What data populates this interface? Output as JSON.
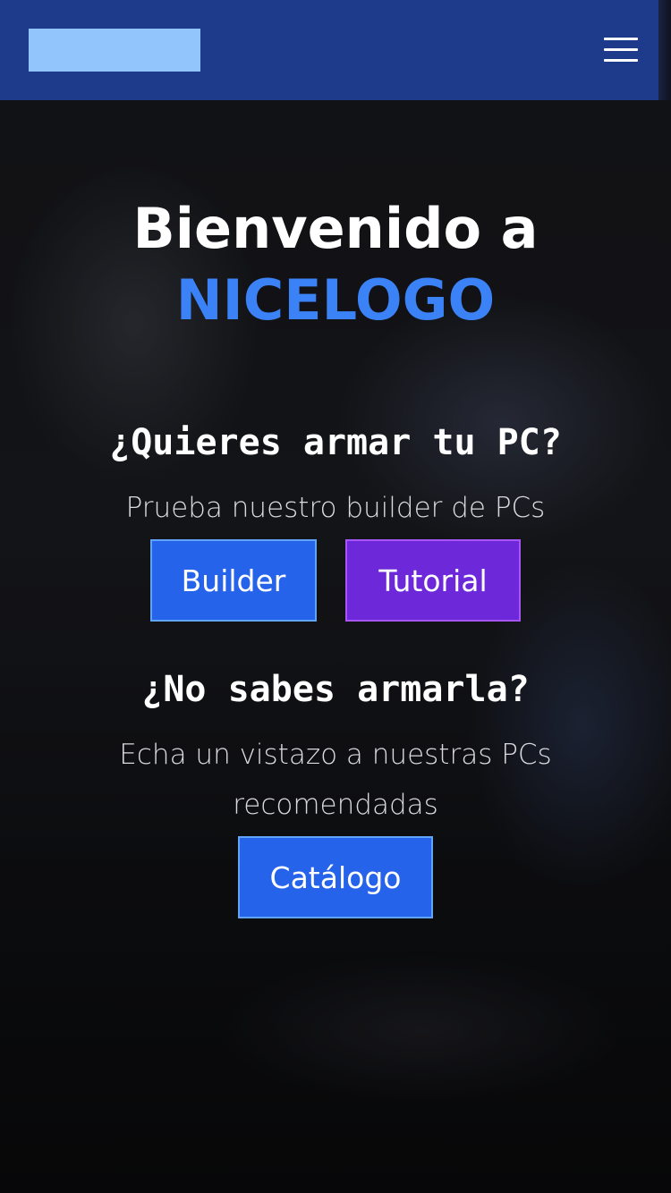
{
  "header": {
    "logo_color": "#93c5fd",
    "background": "#1e3a8a",
    "menu_icon": "hamburger-menu-icon"
  },
  "hero": {
    "title_prefix": "Bienvenido a",
    "brand": "NICELOGO"
  },
  "build_section": {
    "heading": "¿Quieres armar tu PC?",
    "subtitle": "Prueba nuestro builder de PCs",
    "builder_label": "Builder",
    "tutorial_label": "Tutorial"
  },
  "catalog_section": {
    "heading": "¿No sabes armarla?",
    "subtitle_line1": "Echa un vistazo a nuestras PCs",
    "subtitle_line2": "recomendadas",
    "catalog_label": "Catálogo"
  },
  "colors": {
    "brand_blue": "#3b82f6",
    "button_blue": "#2563eb",
    "button_purple": "#6d28d9"
  }
}
